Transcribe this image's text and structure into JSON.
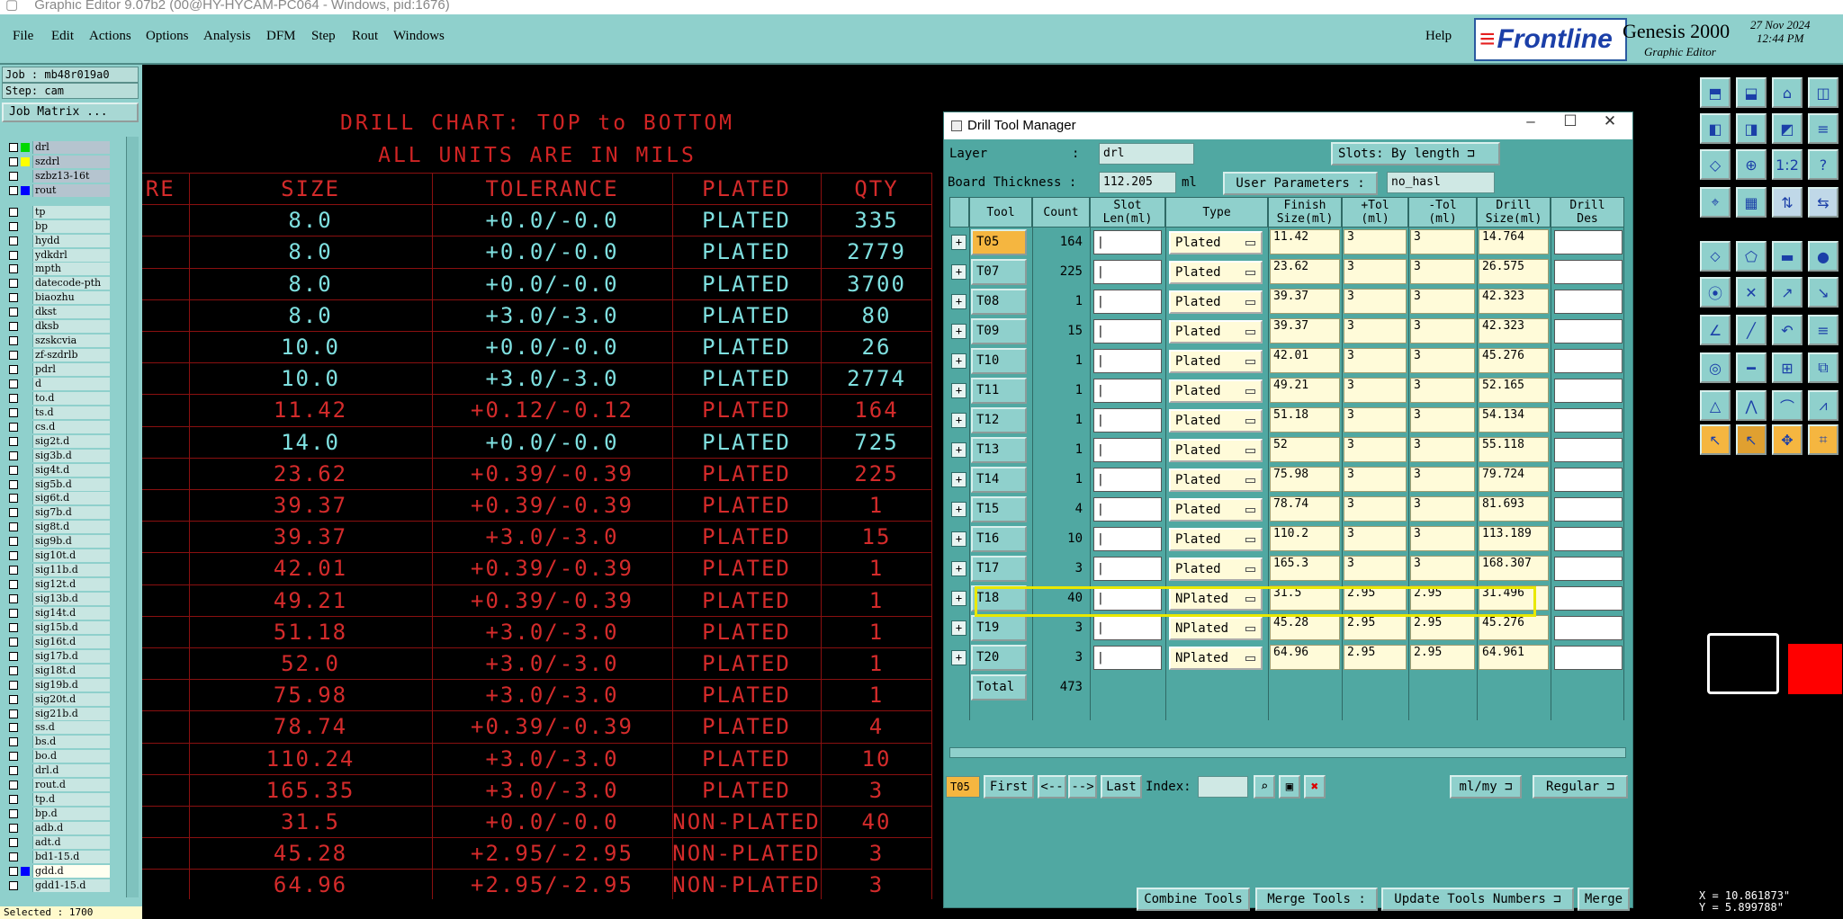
{
  "window_title": "Graphic Editor 9.07b2 (00@HY-HYCAM-PC064 - Windows, pid:1676)",
  "menu": [
    "File",
    "Edit",
    "Actions",
    "Options",
    "Analysis",
    "DFM",
    "Step",
    "Rout",
    "Windows"
  ],
  "help": "Help",
  "brand": {
    "logo": "Frontline",
    "product": "Genesis 2000",
    "subtitle": "Graphic Editor",
    "date": "27 Nov 2024",
    "time": "12:44 PM"
  },
  "job": "Job : mb48r019a0",
  "step": "Step: cam",
  "job_matrix": "Job Matrix ...",
  "layers": [
    {
      "name": "drl",
      "color": "#00d800",
      "state": "sel"
    },
    {
      "name": "szdrl",
      "color": "#ffff00",
      "state": "sel"
    },
    {
      "name": "szbz13-16t",
      "color": "",
      "state": "sel"
    },
    {
      "name": "rout",
      "color": "#0000ff",
      "state": "sel"
    },
    {
      "name": "",
      "color": "",
      "state": "gap"
    },
    {
      "name": "tp",
      "color": ""
    },
    {
      "name": "bp",
      "color": ""
    },
    {
      "name": "hydd",
      "color": ""
    },
    {
      "name": "ydkdrl",
      "color": ""
    },
    {
      "name": "mpth",
      "color": ""
    },
    {
      "name": "datecode-pth",
      "color": ""
    },
    {
      "name": "biaozhu",
      "color": ""
    },
    {
      "name": "dkst",
      "color": ""
    },
    {
      "name": "dksb",
      "color": ""
    },
    {
      "name": "szskcvia",
      "color": ""
    },
    {
      "name": "zf-szdrlb",
      "color": ""
    },
    {
      "name": "pdrl",
      "color": ""
    },
    {
      "name": "d",
      "color": ""
    },
    {
      "name": "to.d",
      "color": ""
    },
    {
      "name": "ts.d",
      "color": ""
    },
    {
      "name": "cs.d",
      "color": ""
    },
    {
      "name": "sig2t.d",
      "color": ""
    },
    {
      "name": "sig3b.d",
      "color": ""
    },
    {
      "name": "sig4t.d",
      "color": ""
    },
    {
      "name": "sig5b.d",
      "color": ""
    },
    {
      "name": "sig6t.d",
      "color": ""
    },
    {
      "name": "sig7b.d",
      "color": ""
    },
    {
      "name": "sig8t.d",
      "color": ""
    },
    {
      "name": "sig9b.d",
      "color": ""
    },
    {
      "name": "sig10t.d",
      "color": ""
    },
    {
      "name": "sig11b.d",
      "color": ""
    },
    {
      "name": "sig12t.d",
      "color": ""
    },
    {
      "name": "sig13b.d",
      "color": ""
    },
    {
      "name": "sig14t.d",
      "color": ""
    },
    {
      "name": "sig15b.d",
      "color": ""
    },
    {
      "name": "sig16t.d",
      "color": ""
    },
    {
      "name": "sig17b.d",
      "color": ""
    },
    {
      "name": "sig18t.d",
      "color": ""
    },
    {
      "name": "sig19b.d",
      "color": ""
    },
    {
      "name": "sig20t.d",
      "color": ""
    },
    {
      "name": "sig21b.d",
      "color": ""
    },
    {
      "name": "ss.d",
      "color": ""
    },
    {
      "name": "bs.d",
      "color": ""
    },
    {
      "name": "bo.d",
      "color": ""
    },
    {
      "name": "drl.d",
      "color": ""
    },
    {
      "name": "rout.d",
      "color": ""
    },
    {
      "name": "tp.d",
      "color": ""
    },
    {
      "name": "bp.d",
      "color": ""
    },
    {
      "name": "adb.d",
      "color": ""
    },
    {
      "name": "adt.d",
      "color": ""
    },
    {
      "name": "bd1-15.d",
      "color": ""
    },
    {
      "name": "gdd.d",
      "color": "#0000ff",
      "state": "active"
    },
    {
      "name": "gdd1-15.d",
      "color": ""
    }
  ],
  "selected": "Selected : 1700",
  "chart": {
    "title1": "DRILL CHART: TOP to BOTTOM",
    "title2": "ALL UNITS ARE IN MILS",
    "headers": [
      "URE",
      "SIZE",
      "TOLERANCE",
      "PLATED",
      "QTY"
    ],
    "rows": [
      {
        "size": "8.0",
        "tol": "+0.0/-0.0",
        "plated": "PLATED",
        "qty": "335",
        "c": "cyan"
      },
      {
        "size": "8.0",
        "tol": "+0.0/-0.0",
        "plated": "PLATED",
        "qty": "2779",
        "c": "cyan"
      },
      {
        "size": "8.0",
        "tol": "+0.0/-0.0",
        "plated": "PLATED",
        "qty": "3700",
        "c": "cyan"
      },
      {
        "size": "8.0",
        "tol": "+3.0/-3.0",
        "plated": "PLATED",
        "qty": "80",
        "c": "cyan"
      },
      {
        "size": "10.0",
        "tol": "+0.0/-0.0",
        "plated": "PLATED",
        "qty": "26",
        "c": "cyan"
      },
      {
        "size": "10.0",
        "tol": "+3.0/-3.0",
        "plated": "PLATED",
        "qty": "2774",
        "c": "cyan"
      },
      {
        "size": "11.42",
        "tol": "+0.12/-0.12",
        "plated": "PLATED",
        "qty": "164",
        "c": "red"
      },
      {
        "size": "14.0",
        "tol": "+0.0/-0.0",
        "plated": "PLATED",
        "qty": "725",
        "c": "cyan"
      },
      {
        "size": "23.62",
        "tol": "+0.39/-0.39",
        "plated": "PLATED",
        "qty": "225",
        "c": "red"
      },
      {
        "size": "39.37",
        "tol": "+0.39/-0.39",
        "plated": "PLATED",
        "qty": "1",
        "c": "red"
      },
      {
        "size": "39.37",
        "tol": "+3.0/-3.0",
        "plated": "PLATED",
        "qty": "15",
        "c": "red"
      },
      {
        "size": "42.01",
        "tol": "+0.39/-0.39",
        "plated": "PLATED",
        "qty": "1",
        "c": "red"
      },
      {
        "size": "49.21",
        "tol": "+0.39/-0.39",
        "plated": "PLATED",
        "qty": "1",
        "c": "red"
      },
      {
        "size": "51.18",
        "tol": "+3.0/-3.0",
        "plated": "PLATED",
        "qty": "1",
        "c": "red"
      },
      {
        "size": "52.0",
        "tol": "+3.0/-3.0",
        "plated": "PLATED",
        "qty": "1",
        "c": "red"
      },
      {
        "size": "75.98",
        "tol": "+3.0/-3.0",
        "plated": "PLATED",
        "qty": "1",
        "c": "red"
      },
      {
        "size": "78.74",
        "tol": "+0.39/-0.39",
        "plated": "PLATED",
        "qty": "4",
        "c": "red"
      },
      {
        "size": "110.24",
        "tol": "+3.0/-3.0",
        "plated": "PLATED",
        "qty": "10",
        "c": "red"
      },
      {
        "size": "165.35",
        "tol": "+3.0/-3.0",
        "plated": "PLATED",
        "qty": "3",
        "c": "red"
      },
      {
        "size": "31.5",
        "tol": "+0.0/-0.0",
        "plated": "NON-PLATED",
        "qty": "40",
        "c": "red"
      },
      {
        "size": "45.28",
        "tol": "+2.95/-2.95",
        "plated": "NON-PLATED",
        "qty": "3",
        "c": "red"
      },
      {
        "size": "64.96",
        "tol": "+2.95/-2.95",
        "plated": "NON-PLATED",
        "qty": "3",
        "c": "red"
      }
    ]
  },
  "dtm": {
    "title": "Drill Tool Manager",
    "layer_label": "Layer",
    "layer_sep": ":",
    "layer_value": "drl",
    "slots_label": "Slots:",
    "slots_value": "By length",
    "thickness_label": "Board Thickness :",
    "thickness_value": "112.205",
    "thickness_unit": "ml",
    "user_params_label": "User Parameters :",
    "user_params_value": "no_hasl",
    "headers": [
      "Tool",
      "Count",
      "Slot\nLen(ml)",
      "Type",
      "Finish\nSize(ml)",
      "+Tol\n(ml)",
      "-Tol\n(ml)",
      "Drill\nSize(ml)",
      "Drill\nDes"
    ],
    "tools": [
      {
        "tool": "T05",
        "count": "164",
        "type": "Plated",
        "finish": "11.42",
        "ptol": "3",
        "ntol": "3",
        "drill": "14.764"
      },
      {
        "tool": "T07",
        "count": "225",
        "type": "Plated",
        "finish": "23.62",
        "ptol": "3",
        "ntol": "3",
        "drill": "26.575"
      },
      {
        "tool": "T08",
        "count": "1",
        "type": "Plated",
        "finish": "39.37",
        "ptol": "3",
        "ntol": "3",
        "drill": "42.323"
      },
      {
        "tool": "T09",
        "count": "15",
        "type": "Plated",
        "finish": "39.37",
        "ptol": "3",
        "ntol": "3",
        "drill": "42.323"
      },
      {
        "tool": "T10",
        "count": "1",
        "type": "Plated",
        "finish": "42.01",
        "ptol": "3",
        "ntol": "3",
        "drill": "45.276"
      },
      {
        "tool": "T11",
        "count": "1",
        "type": "Plated",
        "finish": "49.21",
        "ptol": "3",
        "ntol": "3",
        "drill": "52.165"
      },
      {
        "tool": "T12",
        "count": "1",
        "type": "Plated",
        "finish": "51.18",
        "ptol": "3",
        "ntol": "3",
        "drill": "54.134"
      },
      {
        "tool": "T13",
        "count": "1",
        "type": "Plated",
        "finish": "52",
        "ptol": "3",
        "ntol": "3",
        "drill": "55.118"
      },
      {
        "tool": "T14",
        "count": "1",
        "type": "Plated",
        "finish": "75.98",
        "ptol": "3",
        "ntol": "3",
        "drill": "79.724"
      },
      {
        "tool": "T15",
        "count": "4",
        "type": "Plated",
        "finish": "78.74",
        "ptol": "3",
        "ntol": "3",
        "drill": "81.693"
      },
      {
        "tool": "T16",
        "count": "10",
        "type": "Plated",
        "finish": "110.2",
        "ptol": "3",
        "ntol": "3",
        "drill": "113.189"
      },
      {
        "tool": "T17",
        "count": "3",
        "type": "Plated",
        "finish": "165.3",
        "ptol": "3",
        "ntol": "3",
        "drill": "168.307"
      },
      {
        "tool": "T18",
        "count": "40",
        "type": "NPlated",
        "finish": "31.5",
        "ptol": "2.95",
        "ntol": "2.95",
        "drill": "31.496"
      },
      {
        "tool": "T19",
        "count": "3",
        "type": "NPlated",
        "finish": "45.28",
        "ptol": "2.95",
        "ntol": "2.95",
        "drill": "45.276"
      },
      {
        "tool": "T20",
        "count": "3",
        "type": "NPlated",
        "finish": "64.96",
        "ptol": "2.95",
        "ntol": "2.95",
        "drill": "64.961"
      }
    ],
    "total_label": "Total",
    "total_value": "473",
    "current_tool": "T05",
    "nav": {
      "first": "First",
      "prev": "<--",
      "next": "-->",
      "last": "Last",
      "index": "Index:"
    },
    "units": "ml/my",
    "mode": "Regular",
    "actions": [
      "Combine Tools",
      "Merge Tools :",
      "Update Tools Numbers",
      "Merge"
    ]
  },
  "coords": {
    "x": "X = 10.861873\"",
    "y": "Y = 5.899788\""
  },
  "colors": {
    "panel": "#8fd0cc",
    "chart_red": "#d42b2b",
    "chart_cyan": "#7fe0e0",
    "highlight": "#e8e800"
  }
}
